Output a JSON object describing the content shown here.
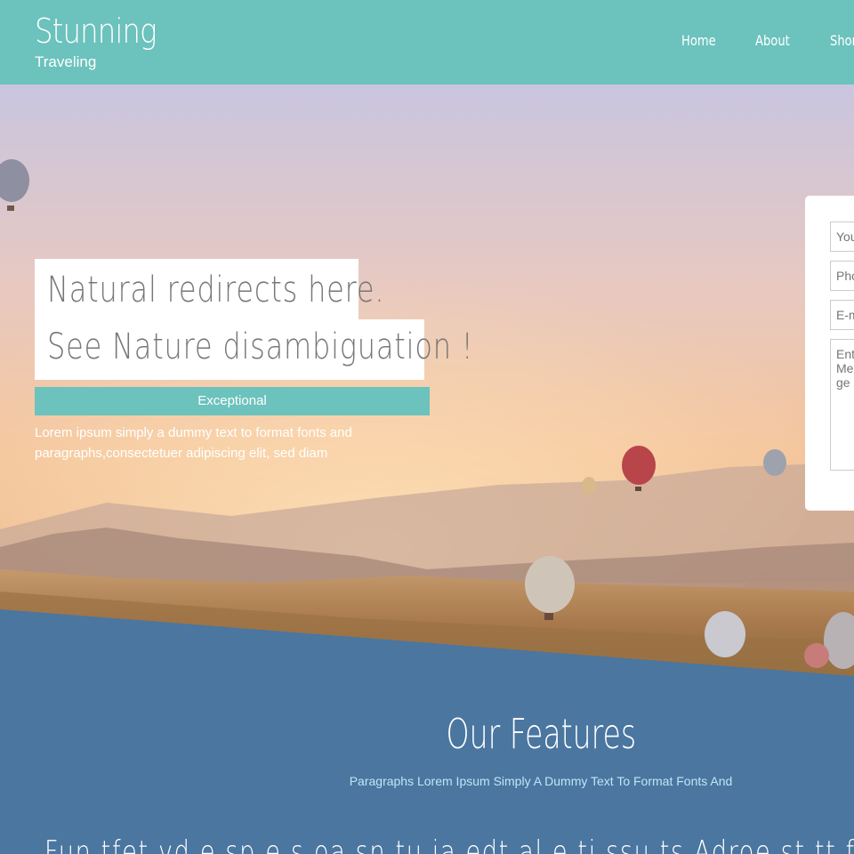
{
  "brand": {
    "title": "Stunning",
    "subtitle": "Traveling"
  },
  "nav": {
    "items": [
      "Home",
      "About",
      "Shortcodes"
    ]
  },
  "hero": {
    "headline_line1": "Natural redirects here.",
    "headline_line2": "See Nature disambiguation !",
    "tagline": "Exceptional",
    "description": "Lorem ipsum simply a dummy text to format fonts and paragraphs,consectetuer adipiscing elit, sed diam"
  },
  "form": {
    "name_placeholder": "Your Name",
    "phone_placeholder": "Phone",
    "email_placeholder": "E-mail",
    "message_placeholder": "Enter Message"
  },
  "features": {
    "title": "Our Features",
    "subtitle": "Paragraphs Lorem Ipsum Simply A Dummy Text To Format Fonts And",
    "item_heading_cut": "Fun tfet vd e sp e s oa sn tu ia edt al e ti ssu ts Adroe st tt f"
  },
  "colors": {
    "header_bg": "#6cc2bd",
    "tagline_bg": "#6cc2bd",
    "features_bg": "#4a76a0"
  }
}
